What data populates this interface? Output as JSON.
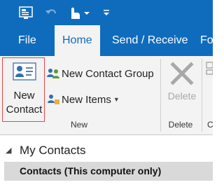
{
  "tabs": [
    {
      "label": "File"
    },
    {
      "label": "Home"
    },
    {
      "label": "Send / Receive"
    },
    {
      "label": "Fo"
    }
  ],
  "ribbon": {
    "new_contact": {
      "line1": "New",
      "line2": "Contact"
    },
    "new_contact_group": "New Contact Group",
    "new_items": "New Items",
    "delete": "Delete",
    "groups": {
      "new": "New",
      "delete": "Delete",
      "clipped": "C"
    }
  },
  "nav": {
    "title": "My Contacts",
    "items": [
      {
        "label": "Contacts (This computer only)"
      }
    ]
  },
  "colors": {
    "accent": "#0f6cbd",
    "ribbon_bg": "#f3f3f3",
    "highlight_border": "#e04848",
    "selected_row": "#d9d9d9"
  },
  "icons": {
    "qat": [
      "outlook-app-icon",
      "undo-icon",
      "touch-mode-icon",
      "customize-qat-icon"
    ],
    "ribbon": [
      "contact-card-icon",
      "contact-group-icon",
      "new-items-icon",
      "delete-x-icon"
    ]
  }
}
